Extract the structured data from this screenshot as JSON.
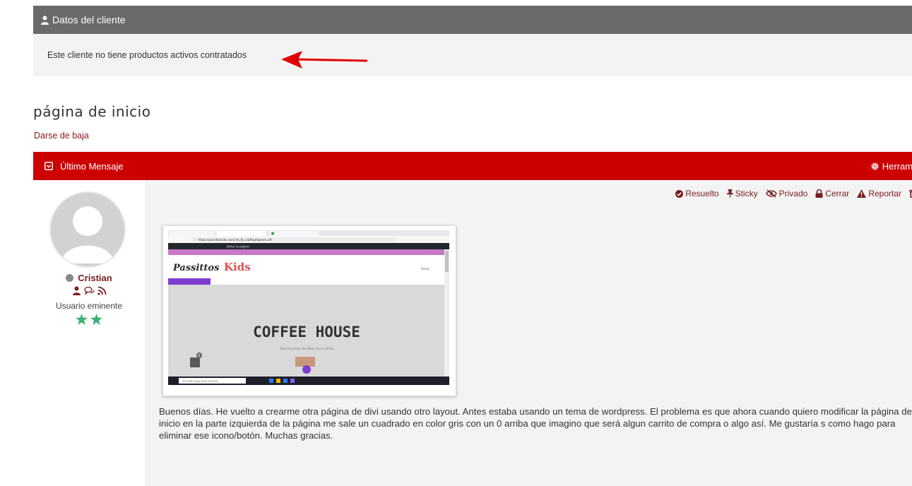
{
  "client": {
    "header": "Datos del cliente",
    "no_products": "Este cliente no tiene productos activos contratados"
  },
  "page": {
    "title": "página de inicio",
    "unsubscribe": "Darse de baja"
  },
  "message_bar": {
    "title": "Último Mensaje",
    "tools": "Herrami"
  },
  "author": {
    "name": "Cristian",
    "rank": "Usuario eminente",
    "stars": 2
  },
  "actions": {
    "resolved": "Resuelto",
    "sticky": "Sticky",
    "private": "Privado",
    "close": "Cerrar",
    "report": "Reportar"
  },
  "attachment": {
    "logo_a": "Passittos",
    "logo_b": "Kids",
    "hero_title": "COFFEE HOUSE",
    "hero_sub": "Serving Only the Best since 2013",
    "url": "https://passittoskids.com/?et_fb=1&PageSpeed=off",
    "badge": "0",
    "search_placeholder": "Escribe aquí para buscar",
    "menu_item": "Inicio",
    "bar_text": "Editar la página"
  },
  "post": {
    "body": "Buenos días. He vuelto a crearme otra página de divi usando otro layout. Antes estaba usando un tema de wordpress. El problema es que ahora cuando quiero modificar la página de inicio en la parte izquierda de la página me sale un cuadrado en color gris con un 0 arriba que imagino que será algun carrito de compra o algo así. Me gustaría s como hago para eliminar ese icono/botón. Muchas gracias."
  },
  "colors": {
    "client_header_bg": "#6a6a6a",
    "message_bar_bg": "#cc0000",
    "link": "#8b1a1a",
    "star": "#3cb371"
  }
}
